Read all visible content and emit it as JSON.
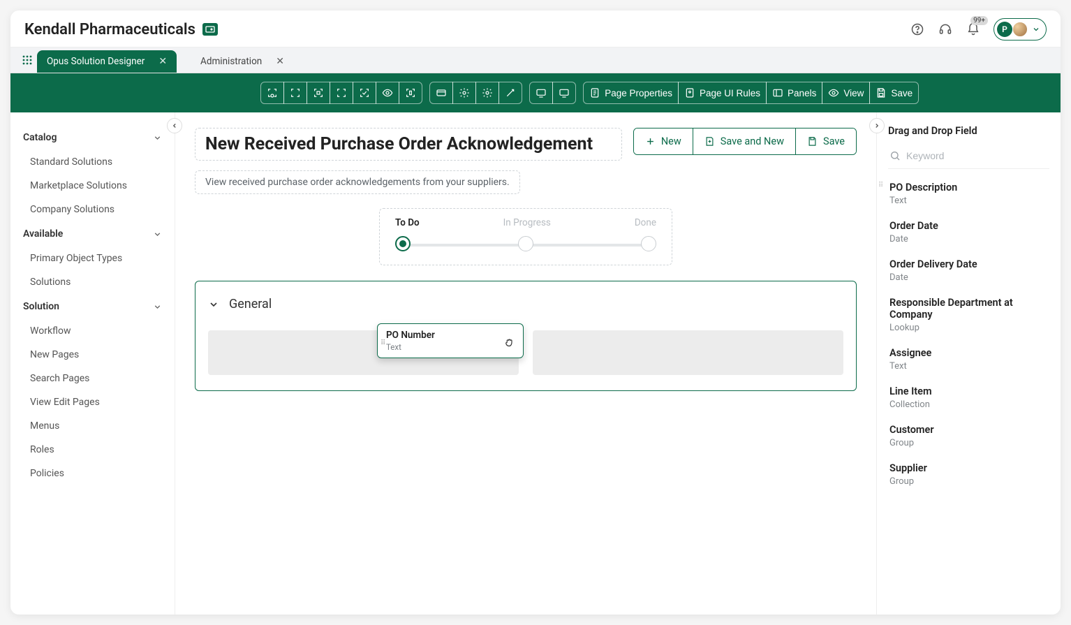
{
  "brand": "Kendall Pharmaceuticals",
  "notifications_badge": "99+",
  "tabs": [
    {
      "label": "Opus Solution Designer",
      "active": true
    },
    {
      "label": "Administration",
      "active": false
    }
  ],
  "toolbar": {
    "page_properties": "Page Properties",
    "page_ui_rules": "Page UI Rules",
    "panels": "Panels",
    "view": "View",
    "save": "Save"
  },
  "sidebar": {
    "groups": [
      {
        "title": "Catalog",
        "items": [
          "Standard Solutions",
          "Marketplace Solutions",
          "Company Solutions"
        ]
      },
      {
        "title": "Available",
        "items": [
          "Primary Object Types",
          "Solutions"
        ]
      },
      {
        "title": "Solution",
        "items": [
          "Workflow",
          "New Pages",
          "Search Pages",
          "View Edit Pages",
          "Menus",
          "Roles",
          "Policies"
        ]
      }
    ]
  },
  "page": {
    "title": "New Received Purchase Order Acknowledgement",
    "subtitle": "View received purchase order acknowledgements from your suppliers.",
    "actions": {
      "new": "New",
      "save_new": "Save and New",
      "save": "Save"
    },
    "progress": {
      "steps": [
        "To Do",
        "In Progress",
        "Done"
      ],
      "active_index": 0
    },
    "section_title": "General",
    "dragging_field": {
      "name": "PO Number",
      "type": "Text"
    }
  },
  "rightpanel": {
    "title": "Drag and Drop Field",
    "search_placeholder": "Keyword",
    "fields": [
      {
        "name": "PO Description",
        "type": "Text",
        "grip": true
      },
      {
        "name": "Order Date",
        "type": "Date"
      },
      {
        "name": "Order Delivery Date",
        "type": "Date"
      },
      {
        "name": "Responsible Department at Company",
        "type": "Lookup"
      },
      {
        "name": "Assignee",
        "type": "Text"
      },
      {
        "name": "Line Item",
        "type": "Collection"
      },
      {
        "name": "Customer",
        "type": "Group"
      },
      {
        "name": "Supplier",
        "type": "Group"
      }
    ]
  }
}
